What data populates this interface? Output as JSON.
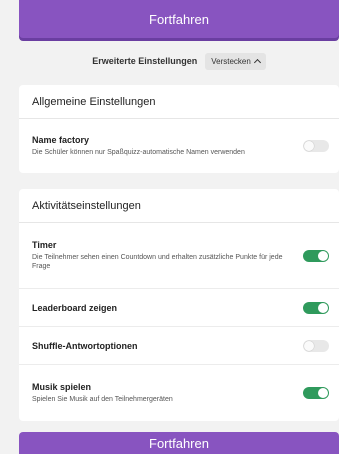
{
  "continue_button_label": "Fortfahren",
  "advanced": {
    "label": "Erweiterte Einstellungen",
    "toggle_label": "Verstecken"
  },
  "general": {
    "heading": "Allgemeine Einstellungen",
    "items": [
      {
        "title": "Name factory",
        "description": "Die Schüler können nur Spaßquizz-automatische Namen verwenden",
        "enabled": false
      }
    ]
  },
  "activity": {
    "heading": "Aktivitätseinstellungen",
    "items": [
      {
        "title": "Timer",
        "description": "Die Teilnehmer sehen einen Countdown und erhalten zusätzliche Punkte für jede Frage",
        "enabled": true
      },
      {
        "title": "Leaderboard zeigen",
        "description": "",
        "enabled": true
      },
      {
        "title": "Shuffle-Antwortoptionen",
        "description": "",
        "enabled": false
      },
      {
        "title": "Musik spielen",
        "description": "Spielen Sie Musik auf den Teilnehmergeräten",
        "enabled": true
      }
    ]
  },
  "colors": {
    "primary": "#8854c0",
    "toggle_on": "#2f9a5c",
    "toggle_off": "#e8e8e8"
  }
}
